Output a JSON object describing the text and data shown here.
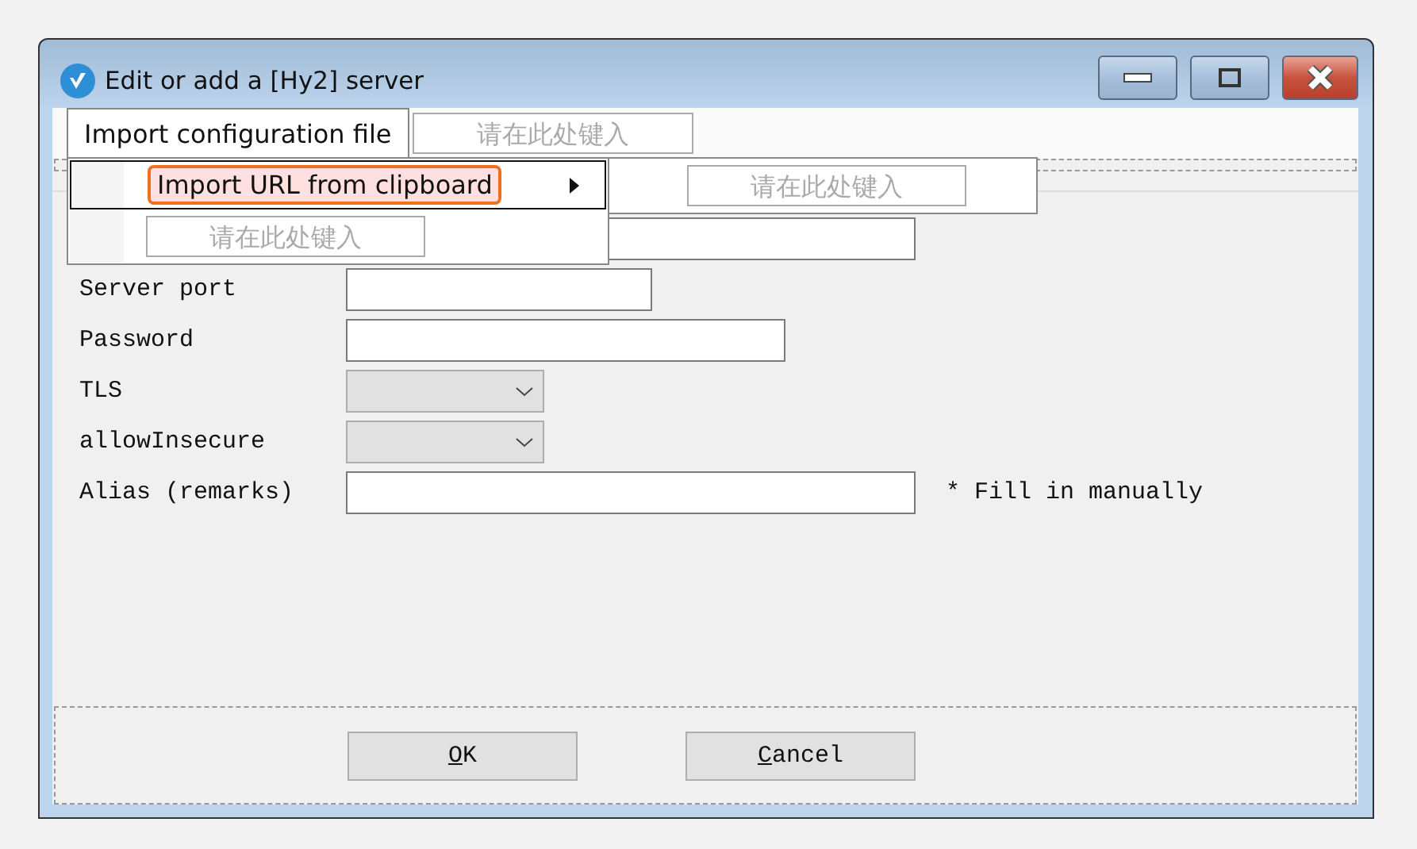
{
  "window": {
    "title": "Edit or add a [Hy2] server"
  },
  "menu_bar": {
    "items": [
      {
        "label": "Import configuration file",
        "selected": true
      }
    ],
    "placeholder": "请在此处键入"
  },
  "dropdown": {
    "items": [
      {
        "label": "Import URL from clipboard",
        "selected": true,
        "has_submenu": true
      }
    ],
    "placeholder": "请在此处键入"
  },
  "submenu": {
    "placeholder": "请在此处键入"
  },
  "form": {
    "rows": [
      {
        "kind": "text"
      },
      {
        "kind": "text",
        "label": "Server port"
      },
      {
        "kind": "text",
        "label": "Password"
      },
      {
        "kind": "select",
        "label": "TLS"
      },
      {
        "kind": "select",
        "label": "allowInsecure"
      },
      {
        "kind": "text",
        "label": "Alias (remarks)",
        "note": "* Fill in manually"
      }
    ]
  },
  "buttons": [
    {
      "label": "OK",
      "access_key_underlined": true
    },
    {
      "label": "Cancel",
      "access_key_underlined": true
    }
  ]
}
